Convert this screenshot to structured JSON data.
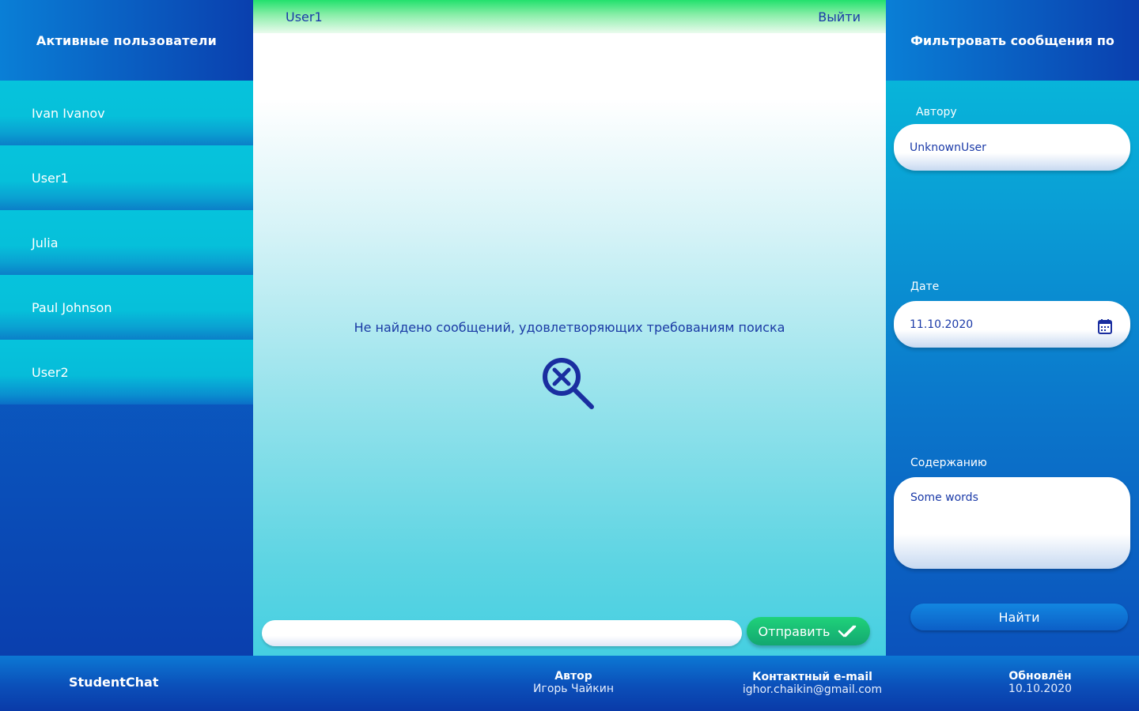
{
  "sidebar": {
    "title": "Активные пользователи",
    "users": [
      {
        "label": "Ivan Ivanov"
      },
      {
        "label": "User1"
      },
      {
        "label": "Julia"
      },
      {
        "label": "Paul Johnson"
      },
      {
        "label": "User2"
      }
    ]
  },
  "chat": {
    "current_user": "User1",
    "logout_label": "Выйти",
    "empty_message": "Не найдено сообщений, удовлетворяющих  требованиям поиска",
    "empty_icon": "search-not-found-icon",
    "composer_value": "",
    "send_label": "Отправить",
    "send_icon": "double-check-icon"
  },
  "filter": {
    "title": "Фильтровать сообщения по",
    "author_label": "Автору",
    "author_value": "UnknownUser",
    "date_label": "Дате",
    "date_value": "11.10.2020",
    "date_icon": "calendar-icon",
    "content_label": "Содержанию",
    "content_value": "Some words",
    "find_label": "Найти"
  },
  "footer": {
    "brand": "StudentChat",
    "author_title": "Автор",
    "author_value": "Игорь Чайкин",
    "contact_title": "Контактный e-mail",
    "contact_value": "ighor.chaikin@gmail.com",
    "updated_title": "Обновлён",
    "updated_value": "10.10.2020"
  },
  "colors": {
    "accent_blue": "#0a3fae",
    "cyan": "#06c3dc",
    "text_dark_blue": "#1a3aa5",
    "send_green": "#13a770",
    "header_green": "#22e16d"
  }
}
